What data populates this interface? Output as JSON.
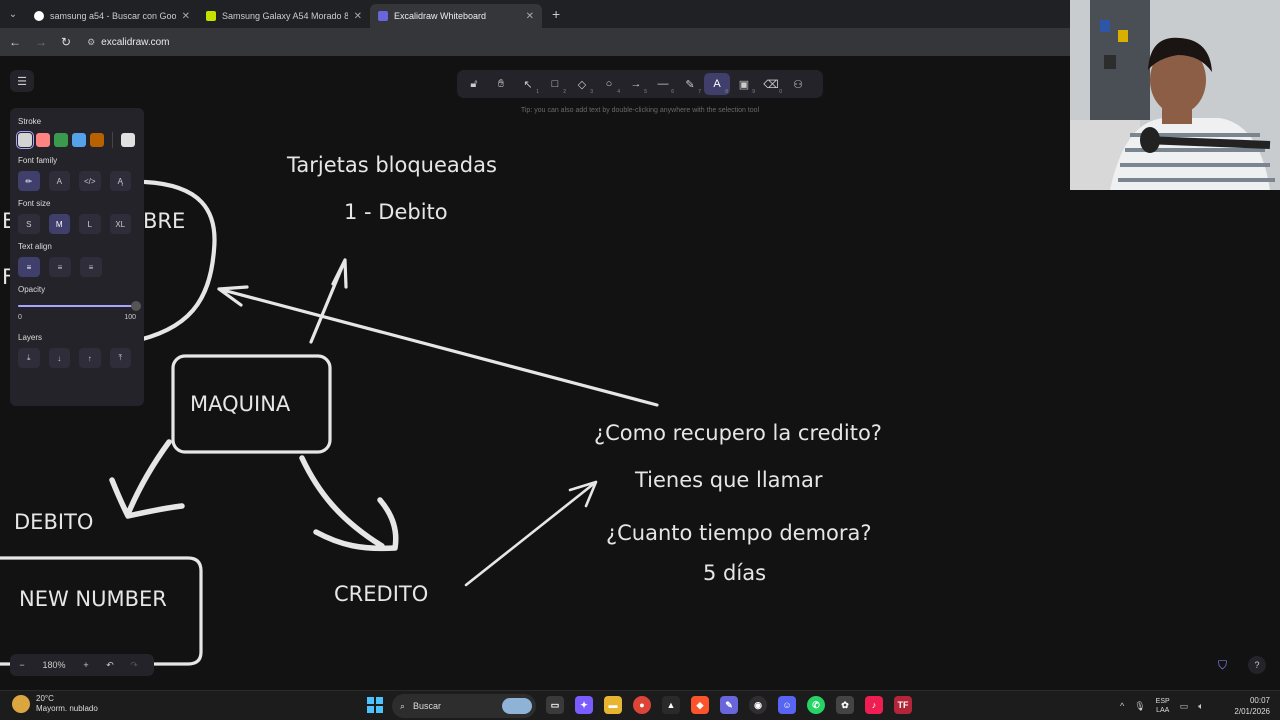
{
  "browser": {
    "tabs": [
      {
        "title": "samsung a54 - Buscar con Goo",
        "icon": "google-icon",
        "color": "#ffffff",
        "active": false
      },
      {
        "title": "Samsung Galaxy A54 Morado 8",
        "icon": "store-icon",
        "color": "#c6e000",
        "active": false
      },
      {
        "title": "Excalidraw Whiteboard",
        "icon": "excalidraw-icon",
        "color": "#6965db",
        "active": true
      }
    ],
    "new_tab": "+",
    "url": "excalidraw.com"
  },
  "toolbar": {
    "tools": [
      {
        "name": "lock",
        "glyph": "🔓︎",
        "num": ""
      },
      {
        "name": "hand",
        "glyph": "✋︎",
        "num": ""
      },
      {
        "name": "selection",
        "glyph": "↖",
        "num": "1"
      },
      {
        "name": "rectangle",
        "glyph": "□",
        "num": "2"
      },
      {
        "name": "diamond",
        "glyph": "◇",
        "num": "3"
      },
      {
        "name": "ellipse",
        "glyph": "○",
        "num": "4"
      },
      {
        "name": "arrow",
        "glyph": "→",
        "num": "5"
      },
      {
        "name": "line",
        "glyph": "—",
        "num": "6"
      },
      {
        "name": "draw",
        "glyph": "✎",
        "num": "7"
      },
      {
        "name": "text",
        "glyph": "A",
        "num": "8"
      },
      {
        "name": "image",
        "glyph": "▣",
        "num": "9"
      },
      {
        "name": "eraser",
        "glyph": "⌫",
        "num": "0"
      },
      {
        "name": "more",
        "glyph": "⚇",
        "num": ""
      }
    ],
    "tip": "Tip: you can also add text by double-clicking anywhere with the selection tool"
  },
  "panel": {
    "stroke_label": "Stroke",
    "stroke_colors": [
      "#d3d3d3",
      "#ff8383",
      "#3a994c",
      "#56a2e8",
      "#b76100"
    ],
    "current_stroke": "#e0e0e0",
    "font_family_label": "Font family",
    "font_families": [
      "✏",
      "A",
      "</>",
      "Ą"
    ],
    "font_size_label": "Font size",
    "font_sizes": [
      "S",
      "M",
      "L",
      "XL"
    ],
    "text_align_label": "Text align",
    "text_aligns": [
      "≡",
      "≡",
      "≡"
    ],
    "opacity_label": "Opacity",
    "opacity_min": "0",
    "opacity_max": "100",
    "opacity_value": 100,
    "layers_label": "Layers",
    "layers": [
      "⤓",
      "↓",
      "↑",
      "⤒"
    ]
  },
  "canvas_text": {
    "tarjetas": "Tarjetas bloqueadas",
    "debito_num": "1 - Debito",
    "bre": "BRE",
    "left_e": "E",
    "left_f": "F",
    "maquina": "MAQUINA",
    "debito": "DEBITO",
    "new_number": "NEW NUMBER",
    "credito": "CREDITO",
    "q1": "¿Como recupero la credito?",
    "a1": "Tienes que llamar",
    "q2": "¿Cuanto tiempo demora?",
    "a2": "5 días"
  },
  "zoom": {
    "minus": "−",
    "value": "180%",
    "plus": "+",
    "undo": "↶",
    "redo": "↷"
  },
  "taskbar": {
    "temp": "20°C",
    "weather": "Mayorm. nublado",
    "search": "Buscar",
    "lang1": "ESP",
    "lang2": "LAA",
    "time": "00:07",
    "date": "2/01/2026"
  }
}
